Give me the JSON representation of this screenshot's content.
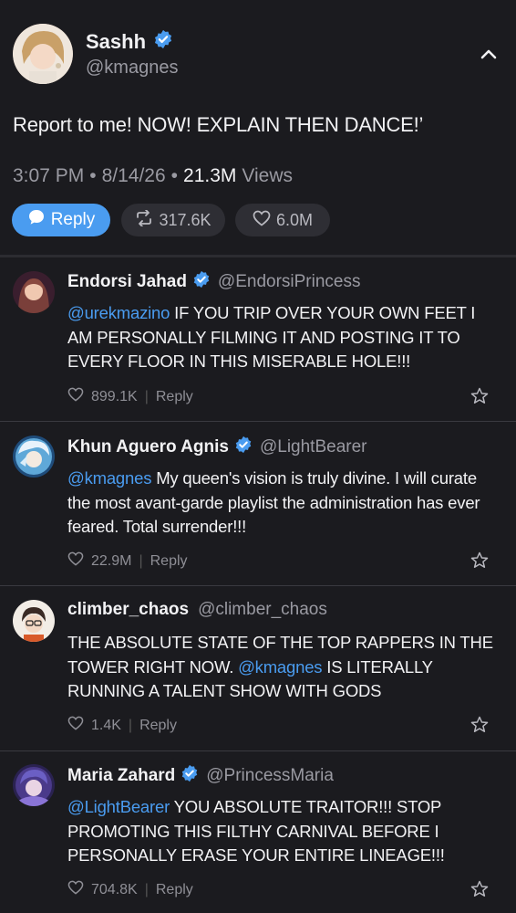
{
  "post": {
    "display_name": "Sashh",
    "handle": "@kmagnes",
    "text": "Report to me! NOW! EXPLAIN THEN DANCE!’",
    "time": "3:07 PM",
    "dot1": "•",
    "date": "8/14/26",
    "dot2": "•",
    "views_count": "21.3M",
    "views_label": "Views",
    "reply_label": "Reply",
    "reposts": "317.6K",
    "likes": "6.0M"
  },
  "replies": [
    {
      "name": "Endorsi Jahad",
      "verified": true,
      "handle": "@EndorsiPrincess",
      "mention": "@urekmazino",
      "text": " IF YOU TRIP OVER YOUR OWN FEET I AM PERSONALLY FILMING IT AND POSTING IT TO EVERY FLOOR IN THIS MISERABLE HOLE!!!",
      "likes": "899.1K",
      "reply_label": "Reply"
    },
    {
      "name": "Khun Aguero Agnis",
      "verified": true,
      "handle": "@LightBearer",
      "mention": "@kmagnes",
      "text": " My queen's vision is truly divine. I will curate the most avant-garde playlist the administration has ever feared. Total surrender!!!",
      "likes": "22.9M",
      "reply_label": "Reply"
    },
    {
      "name": "climber_chaos",
      "verified": false,
      "handle": "@climber_chaos",
      "text_before": "THE ABSOLUTE STATE OF THE TOP RAPPERS IN THE TOWER RIGHT NOW. ",
      "mention": "@kmagnes",
      "text_after": " IS LITERALLY RUNNING A TALENT SHOW WITH GODS",
      "likes": "1.4K",
      "reply_label": "Reply"
    },
    {
      "name": "Maria Zahard",
      "verified": true,
      "handle": "@PrincessMaria",
      "mention": "@LightBearer",
      "text": " YOU ABSOLUTE TRAITOR!!! STOP PROMOTING THIS FILTHY CARNIVAL BEFORE I PERSONALLY ERASE YOUR ENTIRE LINEAGE!!!",
      "likes": "704.8K",
      "reply_label": "Reply"
    }
  ],
  "icons": {
    "verified": "verified-badge-icon",
    "collapse": "chevron-up-icon",
    "reply": "speech-bubble-icon",
    "repost": "repost-icon",
    "like": "heart-icon",
    "favorite": "star-icon"
  },
  "colors": {
    "background": "#1b1b1f",
    "accent": "#4a9cf0",
    "verified": "#4a9cf0",
    "pill": "#2e2e34"
  }
}
